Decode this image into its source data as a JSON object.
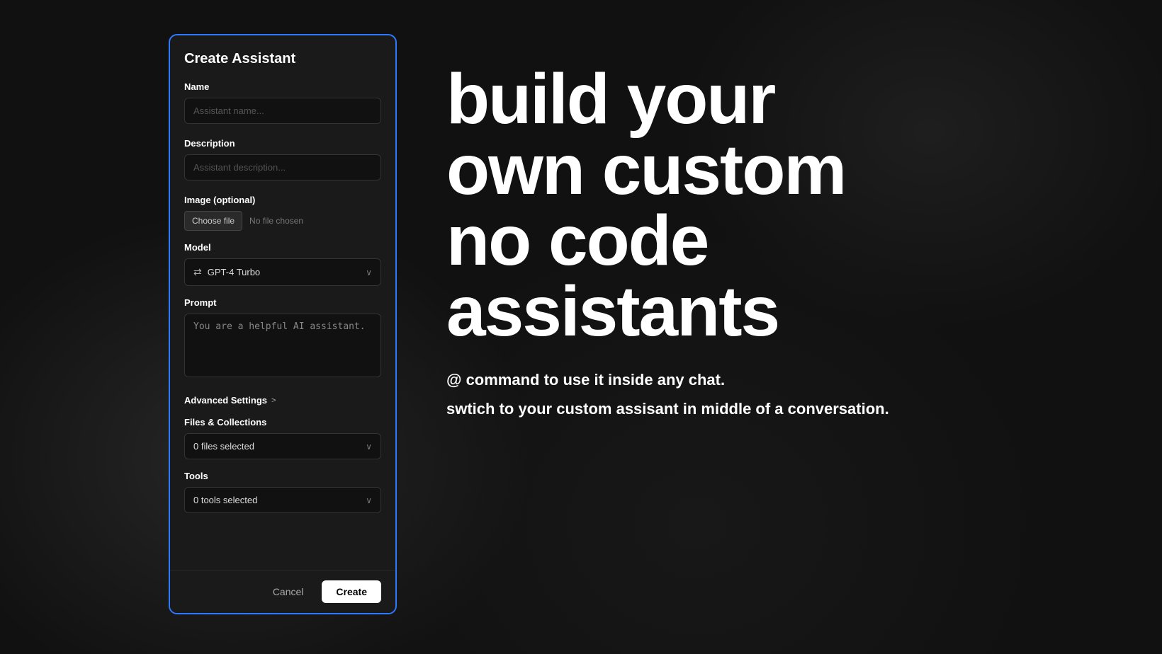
{
  "panel": {
    "title": "Create Assistant",
    "name_label": "Name",
    "name_placeholder": "Assistant name...",
    "description_label": "Description",
    "description_placeholder": "Assistant description...",
    "image_label": "Image (optional)",
    "choose_file_btn": "Choose file",
    "no_file_text": "No file chosen",
    "model_label": "Model",
    "model_value": "GPT-4 Turbo",
    "prompt_label": "Prompt",
    "prompt_value": "You are a helpful AI assistant.",
    "advanced_settings_label": "Advanced Settings",
    "advanced_chevron": ">",
    "files_label": "Files & Collections",
    "files_value": "0 files selected",
    "tools_label": "Tools",
    "tools_value": "0 tools selected",
    "cancel_btn": "Cancel",
    "create_btn": "Create"
  },
  "hero": {
    "line1": "build your",
    "line2": "own custom",
    "line3": "no code",
    "line4": "assistants",
    "sub1": "@ command to use it inside any chat.",
    "sub2": "swtich to your custom assisant in middle of a conversation."
  },
  "icons": {
    "model_icon": "⇄",
    "chevron_down": "∨",
    "chevron_right": ">"
  }
}
